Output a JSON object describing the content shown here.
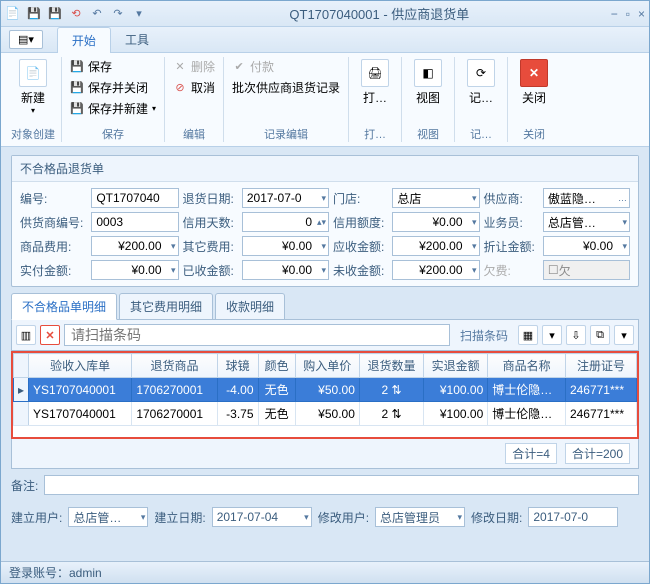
{
  "window": {
    "title": "QT1707040001 - 供应商退货单"
  },
  "menu": {
    "tab_start": "开始",
    "tab_tools": "工具"
  },
  "ribbon": {
    "new": "新建",
    "new_group": "对象创建",
    "save": "保存",
    "save_close": "保存并关闭",
    "save_new": "保存并新建",
    "save_group": "保存",
    "delete": "删除",
    "cancel": "取消",
    "edit_group": "编辑",
    "pay": "付款",
    "batch": "批次供应商退货记录",
    "record_group": "记录编辑",
    "print": "打…",
    "view": "视图",
    "log": "记…",
    "close": "关闭"
  },
  "panel": {
    "title": "不合格品退货单"
  },
  "form": {
    "code_l": "编号:",
    "code": "QT1707040",
    "return_date_l": "退货日期:",
    "return_date": "2017-07-0",
    "store_l": "门店:",
    "store": "总店",
    "supplier_l": "供应商:",
    "supplier": "傲蓝隐…",
    "supplier_code_l": "供货商编号:",
    "supplier_code": "0003",
    "credit_days_l": "信用天数:",
    "credit_days": "0",
    "credit_limit_l": "信用额度:",
    "credit_limit": "¥0.00",
    "clerk_l": "业务员:",
    "clerk": "总店管…",
    "goods_fee_l": "商品费用:",
    "goods_fee": "¥200.00",
    "other_fee_l": "其它费用:",
    "other_fee": "¥0.00",
    "recv_amt_l": "应收金额:",
    "recv_amt": "¥200.00",
    "discount_l": "折让金额:",
    "discount": "¥0.00",
    "paid_l": "实付金额:",
    "paid": "¥0.00",
    "received_l": "已收金额:",
    "received": "¥0.00",
    "unreceived_l": "未收金额:",
    "unreceived": "¥200.00",
    "debt_l": "欠费:",
    "debt": "欠"
  },
  "tabs": {
    "detail": "不合格品单明细",
    "other": "其它费用明细",
    "receipt": "收款明细"
  },
  "scan": {
    "placeholder": "请扫描条码",
    "label": "扫描条码"
  },
  "grid": {
    "cols": [
      "验收入库单",
      "退货商品",
      "球镜",
      "颜色",
      "购入单价",
      "退货数量",
      "实退金额",
      "商品名称",
      "注册证号"
    ],
    "rows": [
      {
        "c0": "YS1707040001",
        "c1": "1706270001",
        "c2": "-4.00",
        "c3": "无色",
        "c4": "¥50.00",
        "c5": "2",
        "c6": "¥100.00",
        "c7": "博士伦隐…",
        "c8": "246771***"
      },
      {
        "c0": "YS1707040001",
        "c1": "1706270001",
        "c2": "-3.75",
        "c3": "无色",
        "c4": "¥50.00",
        "c5": "2",
        "c6": "¥100.00",
        "c7": "博士伦隐…",
        "c8": "246771***"
      }
    ]
  },
  "summary": {
    "count": "合计=4",
    "sum": "合计=200"
  },
  "footer": {
    "remark_l": "备注:",
    "create_user_l": "建立用户:",
    "create_user": "总店管…",
    "create_date_l": "建立日期:",
    "create_date": "2017-07-04",
    "mod_user_l": "修改用户:",
    "mod_user": "总店管理员",
    "mod_date_l": "修改日期:",
    "mod_date": "2017-07-0"
  },
  "status": {
    "login": "登录账号：admin"
  }
}
